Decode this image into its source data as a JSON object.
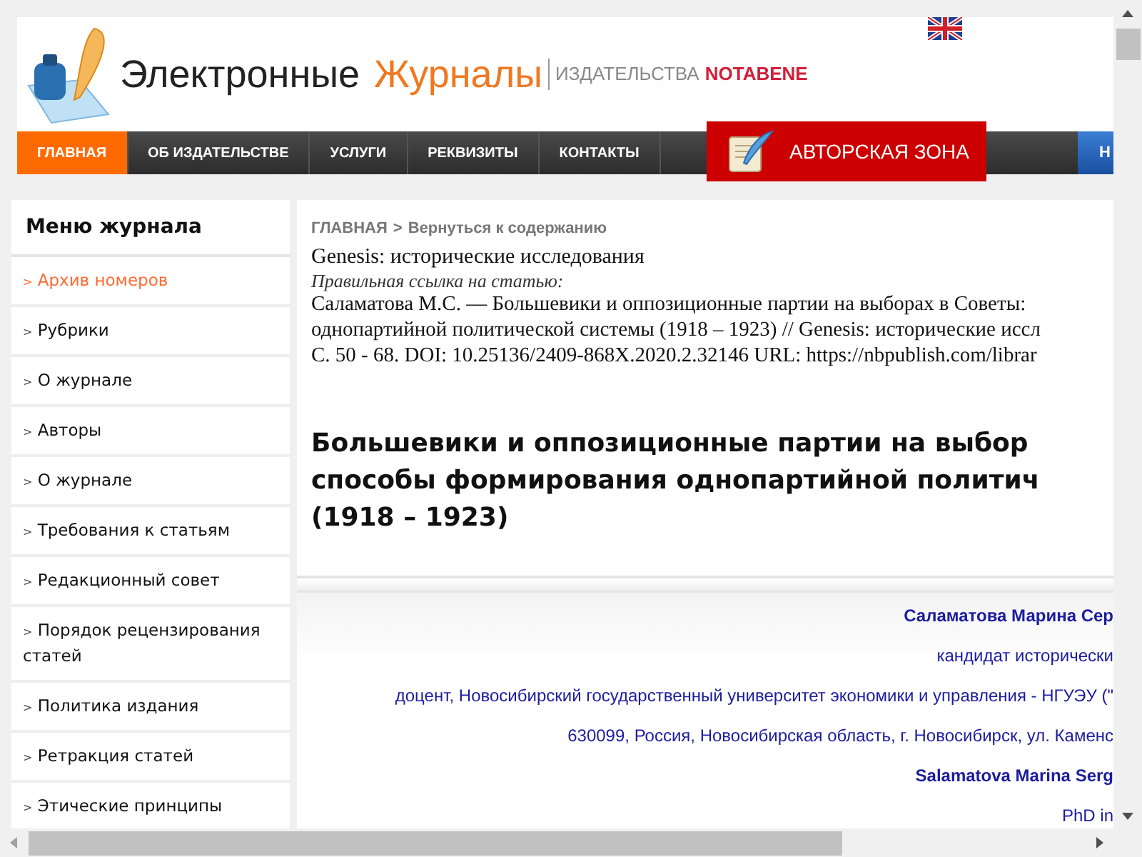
{
  "header": {
    "logo_word_1": "Электронные",
    "logo_word_2": "Журналы",
    "publisher_label": "ИЗДАТЕЛЬСТВА",
    "publisher_name": "NOTABENE"
  },
  "nav": {
    "items": [
      {
        "label": "ГЛАВНАЯ",
        "selected": true
      },
      {
        "label": "ОБ ИЗДАТЕЛЬСТВЕ",
        "selected": false
      },
      {
        "label": "УСЛУГИ",
        "selected": false
      },
      {
        "label": "РЕКВИЗИТЫ",
        "selected": false
      },
      {
        "label": "КОНТАКТЫ",
        "selected": false
      }
    ],
    "author_zone": "АВТОРСКАЯ ЗОНА",
    "cut_item": "Н"
  },
  "sidebar": {
    "title": "Меню журнала",
    "items": [
      {
        "marker": ">",
        "label": "Архив номеров",
        "selected": true
      },
      {
        "marker": ">",
        "label": "Рубрики",
        "selected": false
      },
      {
        "marker": ">",
        "label": "О журнале",
        "selected": false
      },
      {
        "marker": ">",
        "label": "Авторы",
        "selected": false
      },
      {
        "marker": ">",
        "label": "О журнале",
        "selected": false
      },
      {
        "marker": ">",
        "label": "Требования к статьям",
        "selected": false
      },
      {
        "marker": ">",
        "label": "Редакционный совет",
        "selected": false
      },
      {
        "marker": ">",
        "label": "Порядок рецензирования статей",
        "selected": false
      },
      {
        "marker": ">",
        "label": "Политика издания",
        "selected": false
      },
      {
        "marker": ">",
        "label": "Ретракция статей",
        "selected": false
      },
      {
        "marker": ">",
        "label": "Этические принципы",
        "selected": false
      }
    ]
  },
  "article": {
    "breadcrumb": {
      "home": "ГЛАВНАЯ",
      "separator": ">",
      "back": "Вернуться к содержанию"
    },
    "journal": "Genesis: исторические исследования",
    "citation_label": "Правильная ссылка на статью:",
    "citation_lines": [
      "Саламатова М.С. — Большевики и оппозиционные партии на выборах в Советы:",
      "однопартийной политической системы (1918 – 1923) // Genesis: исторические иссл",
      "С. 50 - 68. DOI: 10.25136/2409-868X.2020.2.32146 URL: https://nbpublish.com/librar"
    ],
    "title_lines": [
      "Большевики и оппозиционные партии на выбор",
      "способы формирования однопартийной политич",
      "(1918 – 1923)"
    ],
    "author_lines": [
      {
        "kind": "name",
        "text": "Саламатова Марина Сер"
      },
      {
        "kind": "plain",
        "text": "кандидат исторически"
      },
      {
        "kind": "plain",
        "text": "доцент, Новосибирский государственный университет экономики и управления - НГУЭУ (\""
      },
      {
        "kind": "plain",
        "text": "630099, Россия, Новосибирская область, г. Новосибирск, ул. Каменс"
      },
      {
        "kind": "name",
        "text": "Salamatova Marina Serg"
      },
      {
        "kind": "plain",
        "text": "PhD in"
      }
    ]
  }
}
